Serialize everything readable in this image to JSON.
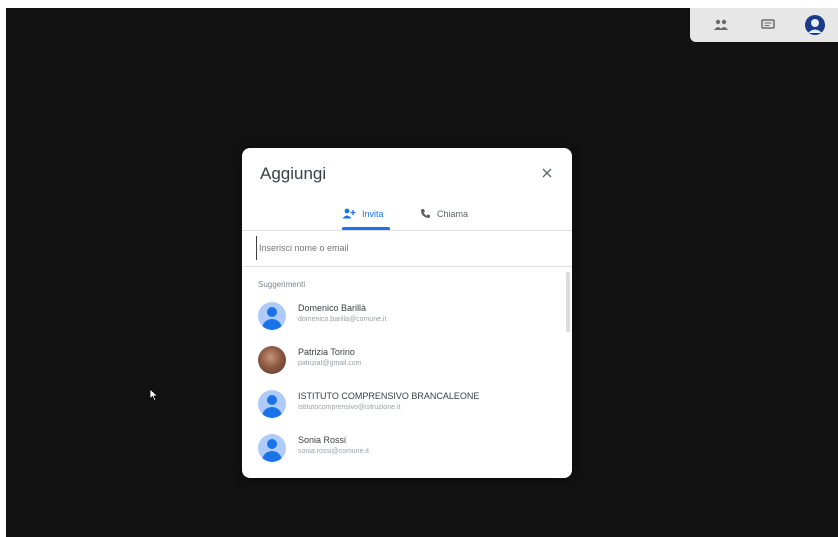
{
  "dialog": {
    "title": "Aggiungi",
    "close_icon": "close-icon",
    "tabs": [
      {
        "label": "Invita",
        "icon": "person-add-icon",
        "active": true
      },
      {
        "label": "Chiama",
        "icon": "phone-icon",
        "active": false
      }
    ],
    "search": {
      "placeholder": "Inserisci nome o email",
      "value": ""
    },
    "suggestions_label": "Suggerimenti",
    "suggestions": [
      {
        "name": "Domenico Barillà",
        "email": "domenico.barilla@comune.it"
      },
      {
        "name": "Patrizia Torino",
        "email": "patriziat@gmail.com"
      },
      {
        "name": "ISTITUTO COMPRENSIVO BRANCALEONE",
        "email": "istitutocomprensivo@istruzione.it"
      },
      {
        "name": "Sonia Rossi",
        "email": "sonia.rossi@comune.it"
      }
    ]
  },
  "topbar": {
    "icons": [
      "people-icon",
      "chat-icon",
      "account-avatar-icon"
    ]
  },
  "colors": {
    "accent": "#1a73e8",
    "background": "#121212",
    "avatar_bg": "#aecbfa"
  }
}
